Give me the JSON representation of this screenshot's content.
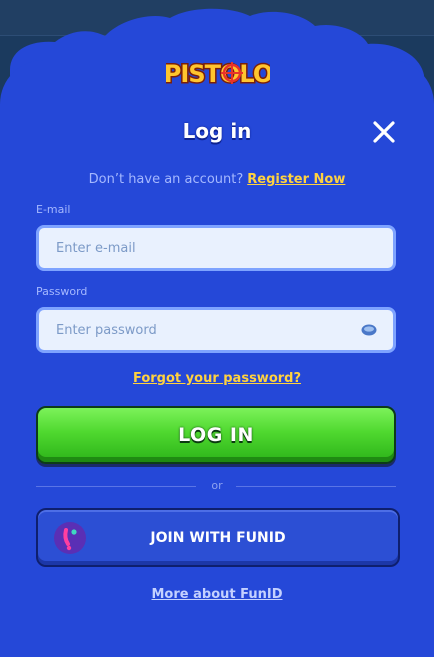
{
  "brand": {
    "logo_text": "PISTOLO"
  },
  "modal": {
    "title": "Log in",
    "signup_prompt": "Don’t have an account?",
    "register_link": "Register Now"
  },
  "form": {
    "email": {
      "label": "E-mail",
      "placeholder": "Enter e-mail",
      "value": ""
    },
    "password": {
      "label": "Password",
      "placeholder": "Enter password",
      "value": ""
    },
    "forgot_link": "Forgot your password?",
    "login_button": "LOG IN"
  },
  "divider_text": "or",
  "funid": {
    "button_label": "JOIN WITH FUNID",
    "more_link": "More about FunID"
  },
  "colors": {
    "modal_bg": "#2548d8",
    "accent_yellow": "#ffd23f",
    "login_green": "#4fd82f",
    "input_bg": "#e9f1fe"
  },
  "icons": [
    "close-icon",
    "eye-icon",
    "funid-logo-icon"
  ]
}
